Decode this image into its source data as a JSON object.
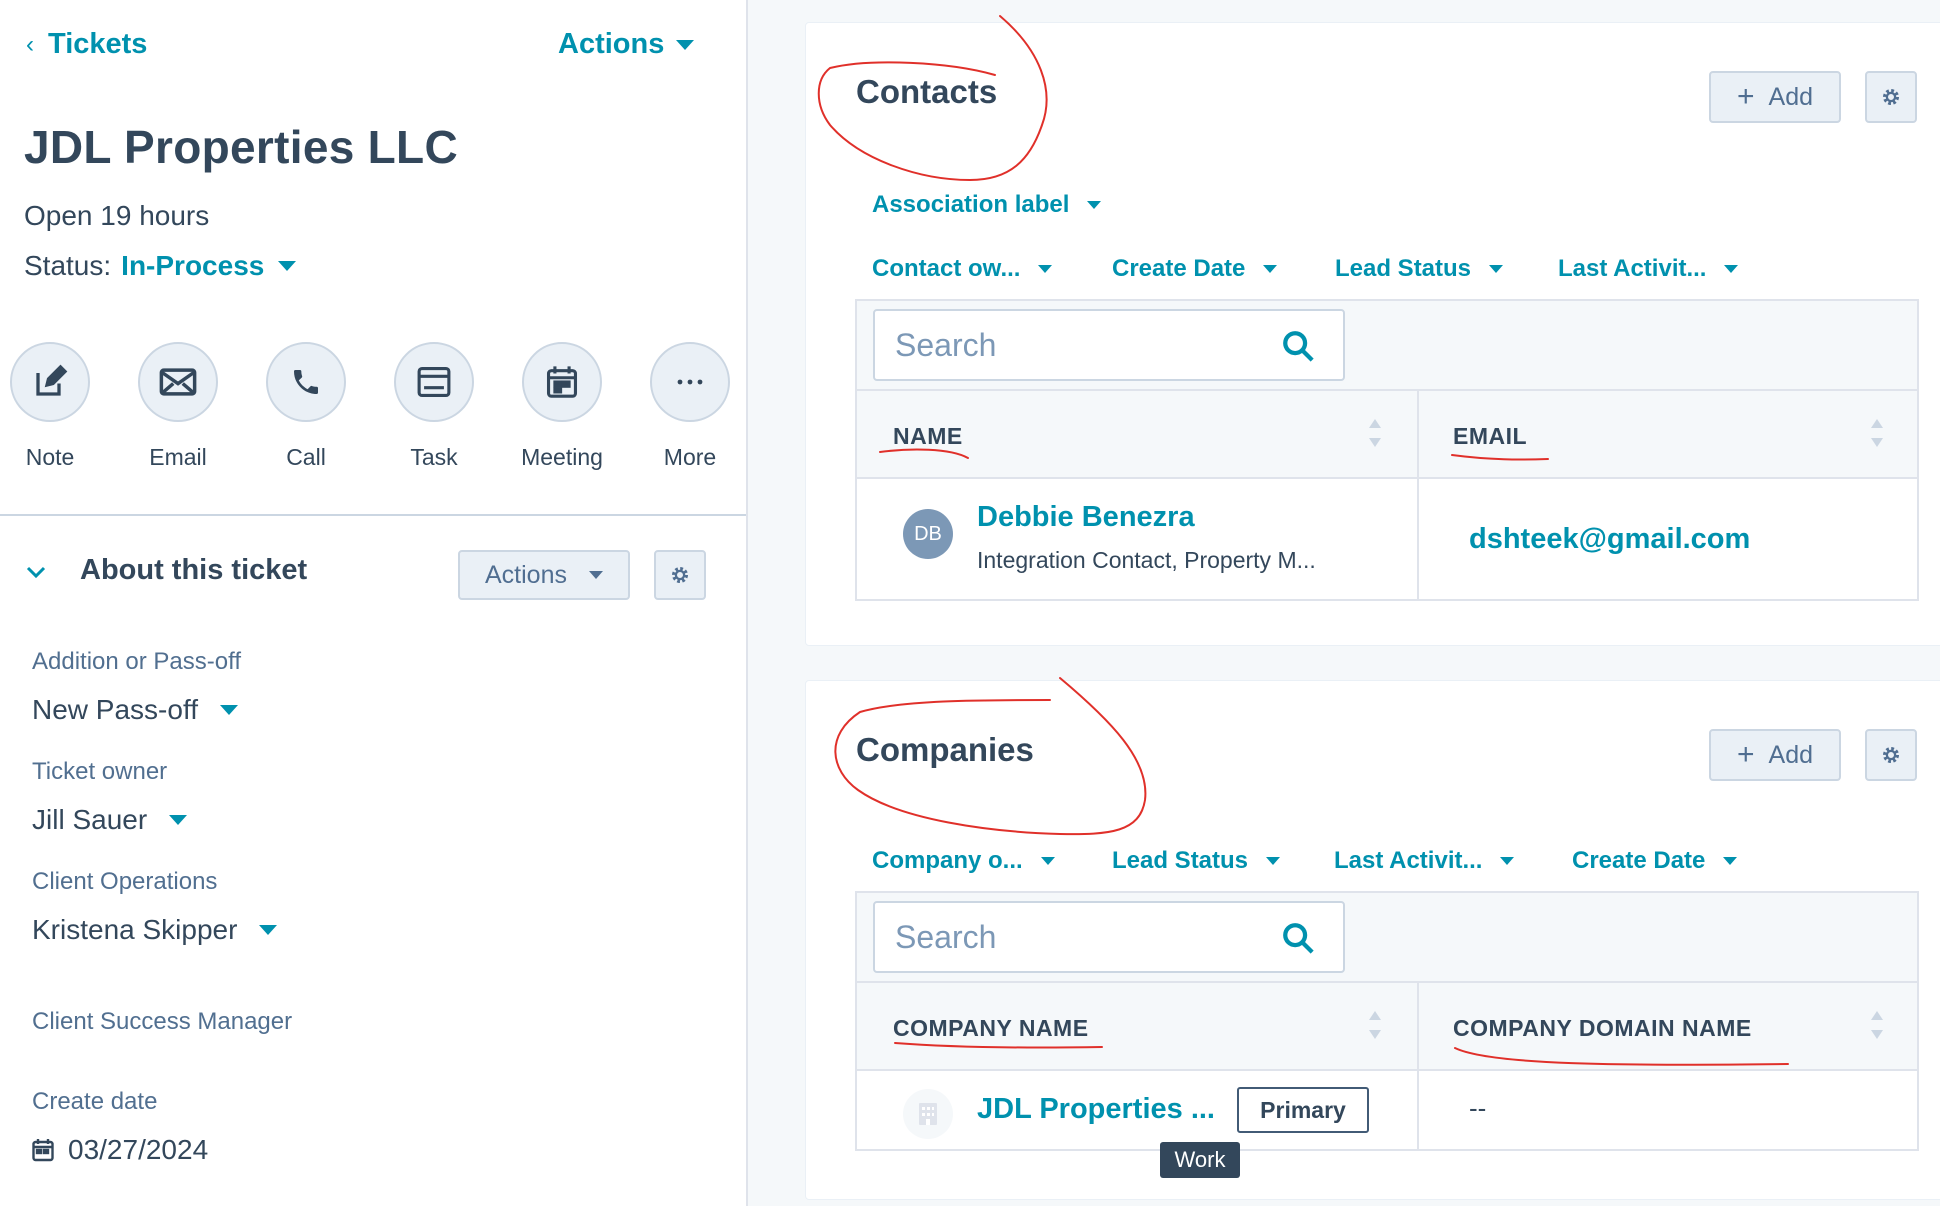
{
  "left": {
    "back_label": "Tickets",
    "actions_label": "Actions",
    "title": "JDL Properties LLC",
    "open_text": "Open 19 hours",
    "status_label": "Status:",
    "status_value": "In-Process",
    "activities": [
      {
        "label": "Note",
        "icon": "note-icon"
      },
      {
        "label": "Email",
        "icon": "email-icon"
      },
      {
        "label": "Call",
        "icon": "call-icon"
      },
      {
        "label": "Task",
        "icon": "task-icon"
      },
      {
        "label": "Meeting",
        "icon": "meeting-icon"
      },
      {
        "label": "More",
        "icon": "more-icon"
      }
    ],
    "about": {
      "title": "About this ticket",
      "actions_label": "Actions"
    },
    "properties": {
      "addition_label": "Addition or Pass-off",
      "addition_value": "New Pass-off",
      "owner_label": "Ticket owner",
      "owner_value": "Jill Sauer",
      "client_ops_label": "Client Operations",
      "client_ops_value": "Kristena Skipper",
      "csm_label": "Client Success Manager",
      "create_date_label": "Create date",
      "create_date_value": "03/27/2024"
    }
  },
  "contacts": {
    "title": "Contacts",
    "add_label": "Add",
    "association_filter": "Association label",
    "filters": [
      "Contact ow...",
      "Create Date",
      "Lead Status",
      "Last Activit..."
    ],
    "search_placeholder": "Search",
    "columns": [
      "NAME",
      "EMAIL"
    ],
    "rows": [
      {
        "initials": "DB",
        "name": "Debbie Benezra",
        "subtitle": "Integration Contact, Property M...",
        "email": "dshteek@gmail.com"
      }
    ]
  },
  "companies": {
    "title": "Companies",
    "add_label": "Add",
    "filters": [
      "Company o...",
      "Lead Status",
      "Last Activit...",
      "Create Date"
    ],
    "search_placeholder": "Search",
    "columns": [
      "COMPANY NAME",
      "COMPANY DOMAIN NAME"
    ],
    "rows": [
      {
        "name": "JDL Properties ...",
        "badge": "Primary",
        "domain": "--"
      }
    ],
    "tooltip": "Work"
  },
  "colors": {
    "accent": "#0091ae",
    "text": "#33475b",
    "annotation": "#e0302a"
  }
}
